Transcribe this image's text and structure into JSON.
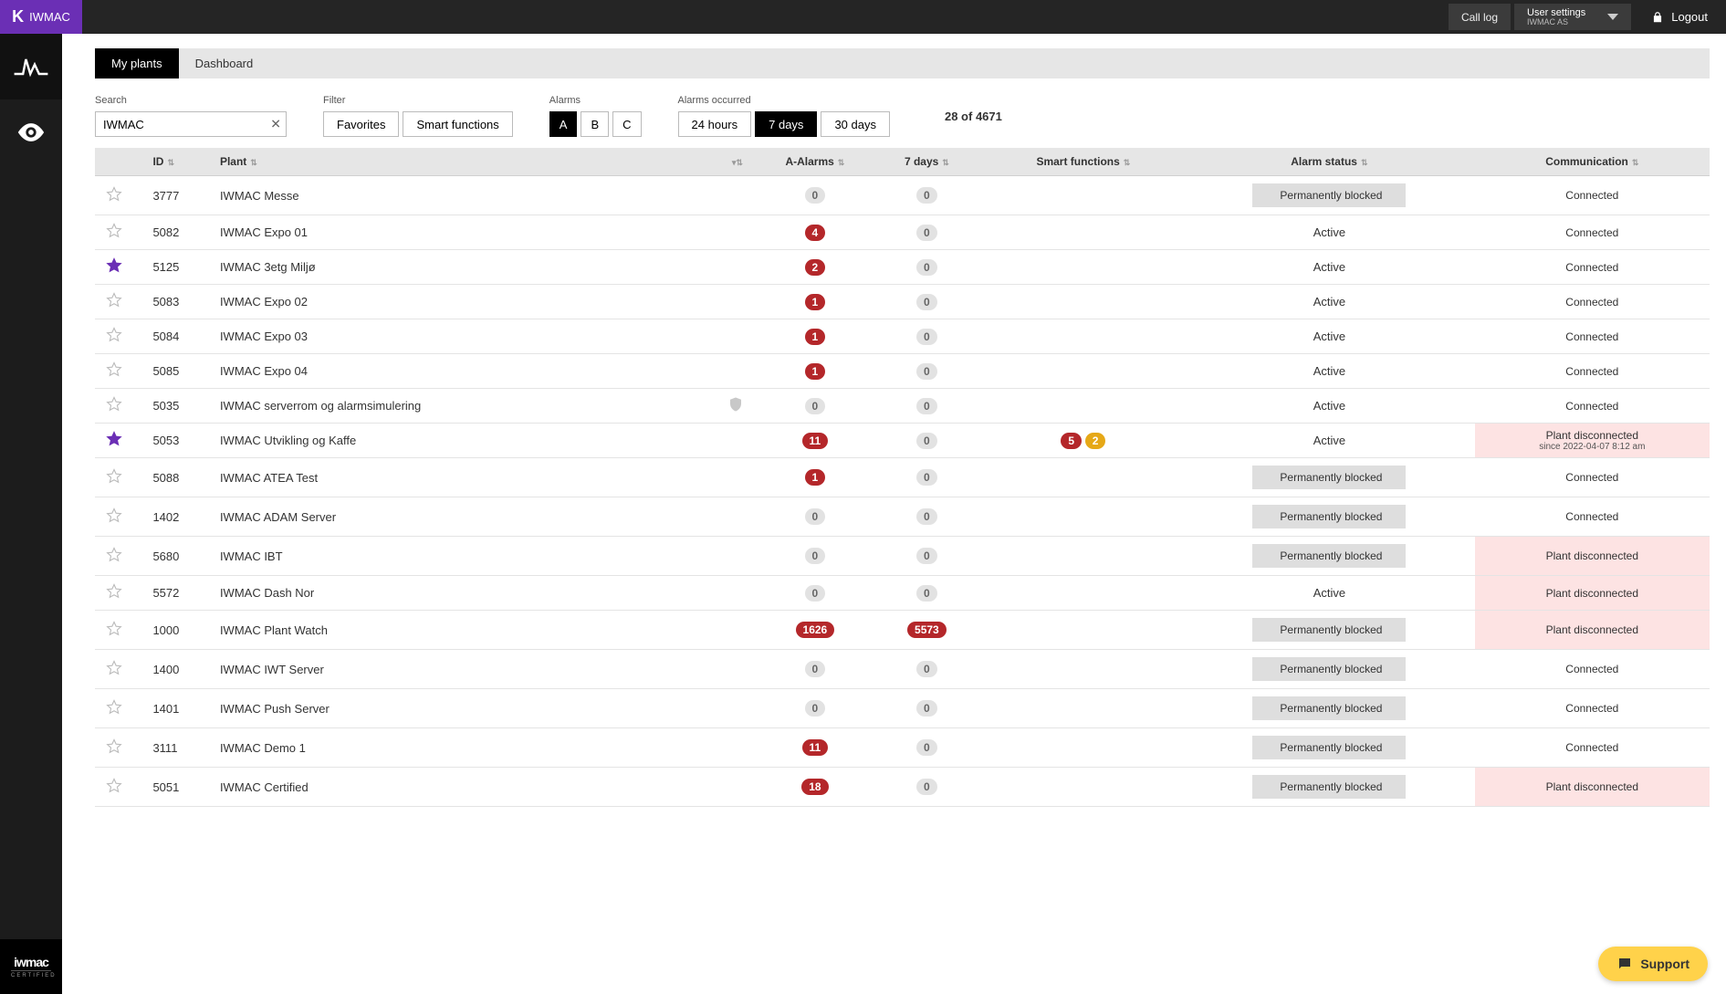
{
  "brand": {
    "k": "K",
    "name": "IWMAC"
  },
  "topbar": {
    "call_log": "Call log",
    "user_settings_title": "User settings",
    "user_settings_sub": "IWMAC AS",
    "logout": "Logout"
  },
  "rail": {
    "footer_logo": "iwmac",
    "footer_sub": "CERTIFIED"
  },
  "tabs": {
    "my_plants": "My plants",
    "dashboard": "Dashboard"
  },
  "search": {
    "label": "Search",
    "value": "IWMAC"
  },
  "filter": {
    "label": "Filter",
    "favorites": "Favorites",
    "smart": "Smart functions"
  },
  "alarm_filter": {
    "label": "Alarms",
    "a": "A",
    "b": "B",
    "c": "C"
  },
  "alarm_occurred": {
    "label": "Alarms occurred",
    "h24": "24 hours",
    "d7": "7 days",
    "d30": "30 days"
  },
  "count": "28 of 4671",
  "columns": {
    "id": "ID",
    "plant": "Plant",
    "icon": "",
    "a_alarms": "A-Alarms",
    "seven_days": "7 days",
    "smart": "Smart functions",
    "alarm_status": "Alarm status",
    "communication": "Communication"
  },
  "status": {
    "perm_blocked": "Permanently blocked",
    "active": "Active"
  },
  "comm": {
    "connected": "Connected",
    "disconnected": "Plant disconnected",
    "disc_since": "since 2022-04-07 8:12 am"
  },
  "support": "Support",
  "rows": [
    {
      "fav": false,
      "id": "3777",
      "plant": "IWMAC Messe",
      "shield": false,
      "a": 0,
      "d7": 0,
      "sf_red": null,
      "sf_or": null,
      "status": "blocked",
      "comm": "connected"
    },
    {
      "fav": false,
      "id": "5082",
      "plant": "IWMAC Expo 01",
      "shield": false,
      "a": 4,
      "d7": 0,
      "sf_red": null,
      "sf_or": null,
      "status": "active",
      "comm": "connected"
    },
    {
      "fav": true,
      "id": "5125",
      "plant": "IWMAC 3etg Miljø",
      "shield": false,
      "a": 2,
      "d7": 0,
      "sf_red": null,
      "sf_or": null,
      "status": "active",
      "comm": "connected"
    },
    {
      "fav": false,
      "id": "5083",
      "plant": "IWMAC Expo 02",
      "shield": false,
      "a": 1,
      "d7": 0,
      "sf_red": null,
      "sf_or": null,
      "status": "active",
      "comm": "connected"
    },
    {
      "fav": false,
      "id": "5084",
      "plant": "IWMAC Expo 03",
      "shield": false,
      "a": 1,
      "d7": 0,
      "sf_red": null,
      "sf_or": null,
      "status": "active",
      "comm": "connected"
    },
    {
      "fav": false,
      "id": "5085",
      "plant": "IWMAC Expo 04",
      "shield": false,
      "a": 1,
      "d7": 0,
      "sf_red": null,
      "sf_or": null,
      "status": "active",
      "comm": "connected"
    },
    {
      "fav": false,
      "id": "5035",
      "plant": "IWMAC serverrom og alarmsimulering",
      "shield": true,
      "a": 0,
      "d7": 0,
      "sf_red": null,
      "sf_or": null,
      "status": "active",
      "comm": "connected"
    },
    {
      "fav": true,
      "id": "5053",
      "plant": "IWMAC Utvikling og Kaffe",
      "shield": false,
      "a": 11,
      "d7": 0,
      "sf_red": 5,
      "sf_or": 2,
      "status": "active",
      "comm": "disc_since"
    },
    {
      "fav": false,
      "id": "5088",
      "plant": "IWMAC ATEA Test",
      "shield": false,
      "a": 1,
      "d7": 0,
      "sf_red": null,
      "sf_or": null,
      "status": "blocked",
      "comm": "connected"
    },
    {
      "fav": false,
      "id": "1402",
      "plant": "IWMAC ADAM Server",
      "shield": false,
      "a": 0,
      "d7": 0,
      "sf_red": null,
      "sf_or": null,
      "status": "blocked",
      "comm": "connected"
    },
    {
      "fav": false,
      "id": "5680",
      "plant": "IWMAC IBT",
      "shield": false,
      "a": 0,
      "d7": 0,
      "sf_red": null,
      "sf_or": null,
      "status": "blocked",
      "comm": "disconnected"
    },
    {
      "fav": false,
      "id": "5572",
      "plant": "IWMAC Dash Nor",
      "shield": false,
      "a": 0,
      "d7": 0,
      "sf_red": null,
      "sf_or": null,
      "status": "active",
      "comm": "disconnected"
    },
    {
      "fav": false,
      "id": "1000",
      "plant": "IWMAC Plant Watch",
      "shield": false,
      "a": 1626,
      "d7": 5573,
      "sf_red": null,
      "sf_or": null,
      "status": "blocked",
      "comm": "disconnected"
    },
    {
      "fav": false,
      "id": "1400",
      "plant": "IWMAC IWT Server",
      "shield": false,
      "a": 0,
      "d7": 0,
      "sf_red": null,
      "sf_or": null,
      "status": "blocked",
      "comm": "connected"
    },
    {
      "fav": false,
      "id": "1401",
      "plant": "IWMAC Push Server",
      "shield": false,
      "a": 0,
      "d7": 0,
      "sf_red": null,
      "sf_or": null,
      "status": "blocked",
      "comm": "connected"
    },
    {
      "fav": false,
      "id": "3111",
      "plant": "IWMAC Demo 1",
      "shield": false,
      "a": 11,
      "d7": 0,
      "sf_red": null,
      "sf_or": null,
      "status": "blocked",
      "comm": "connected"
    },
    {
      "fav": false,
      "id": "5051",
      "plant": "IWMAC Certified",
      "shield": false,
      "a": 18,
      "d7": 0,
      "sf_red": null,
      "sf_or": null,
      "status": "blocked",
      "comm": "disconnected"
    }
  ]
}
